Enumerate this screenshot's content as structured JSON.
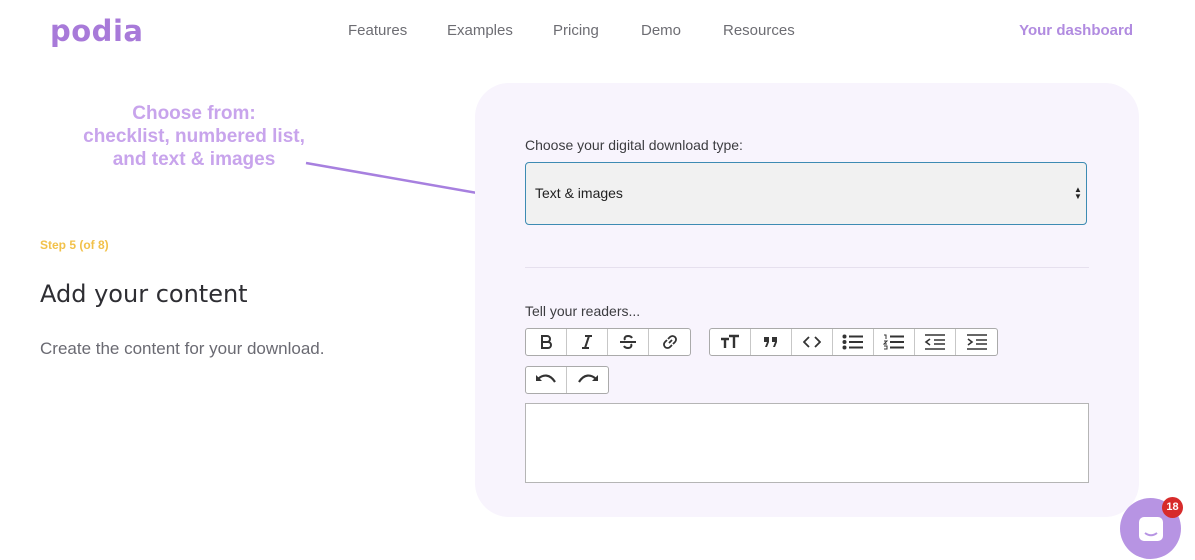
{
  "header": {
    "logo": "podia",
    "nav": [
      "Features",
      "Examples",
      "Pricing",
      "Demo",
      "Resources"
    ],
    "dashboard_link": "Your dashboard"
  },
  "annotation": {
    "line1": "Choose from:",
    "line2": "checklist, numbered list,",
    "line3": "and text & images"
  },
  "left": {
    "step": "Step 5 (of 8)",
    "title": "Add your content",
    "subtitle": "Create the content for your download."
  },
  "form": {
    "type_label": "Choose your digital download type:",
    "type_value": "Text & images",
    "readers_label": "Tell your readers...",
    "editor_value": ""
  },
  "toolbar": {
    "group1": [
      "bold-icon",
      "italic-icon",
      "strikethrough-icon",
      "link-icon"
    ],
    "group2": [
      "heading-icon",
      "quote-icon",
      "code-icon",
      "bullet-list-icon",
      "numbered-list-icon",
      "outdent-icon",
      "indent-icon"
    ],
    "group3": [
      "undo-icon",
      "redo-icon"
    ]
  },
  "chat": {
    "badge_count": "18"
  },
  "colors": {
    "brand": "#a87ad9",
    "panel_bg": "#f8f4fd",
    "step": "#f2c14a",
    "select_border": "#3d8bb3",
    "badge": "#d72b2b"
  }
}
